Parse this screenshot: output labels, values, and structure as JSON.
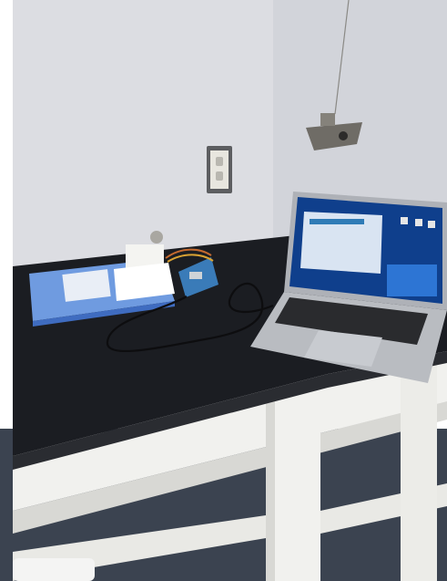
{
  "scene": {
    "kind": "photograph",
    "subject": "lab-bench-with-laptop-and-microcontroller",
    "colors": {
      "wall": "#dcdde2",
      "wall_shadow": "#c9cbd1",
      "bench_top": "#1b1d22",
      "bench_edge": "#2a2c31",
      "table_frame": "#f1f1ee",
      "table_frame_shade": "#d8d8d4",
      "carpet": "#3b4350",
      "laptop_body": "#b9bcc1",
      "laptop_screen_bg": "#0f3f8c",
      "laptop_keys": "#2a2b2e",
      "binder": "#6f9be0",
      "outlet_plate": "#e8e6df",
      "board": "#3a7bb8",
      "sensor": "#7e7b74",
      "cable": "#0d0d0f"
    },
    "icons": [
      "desktop-icon",
      "window-icon",
      "keyboard-icon"
    ]
  }
}
